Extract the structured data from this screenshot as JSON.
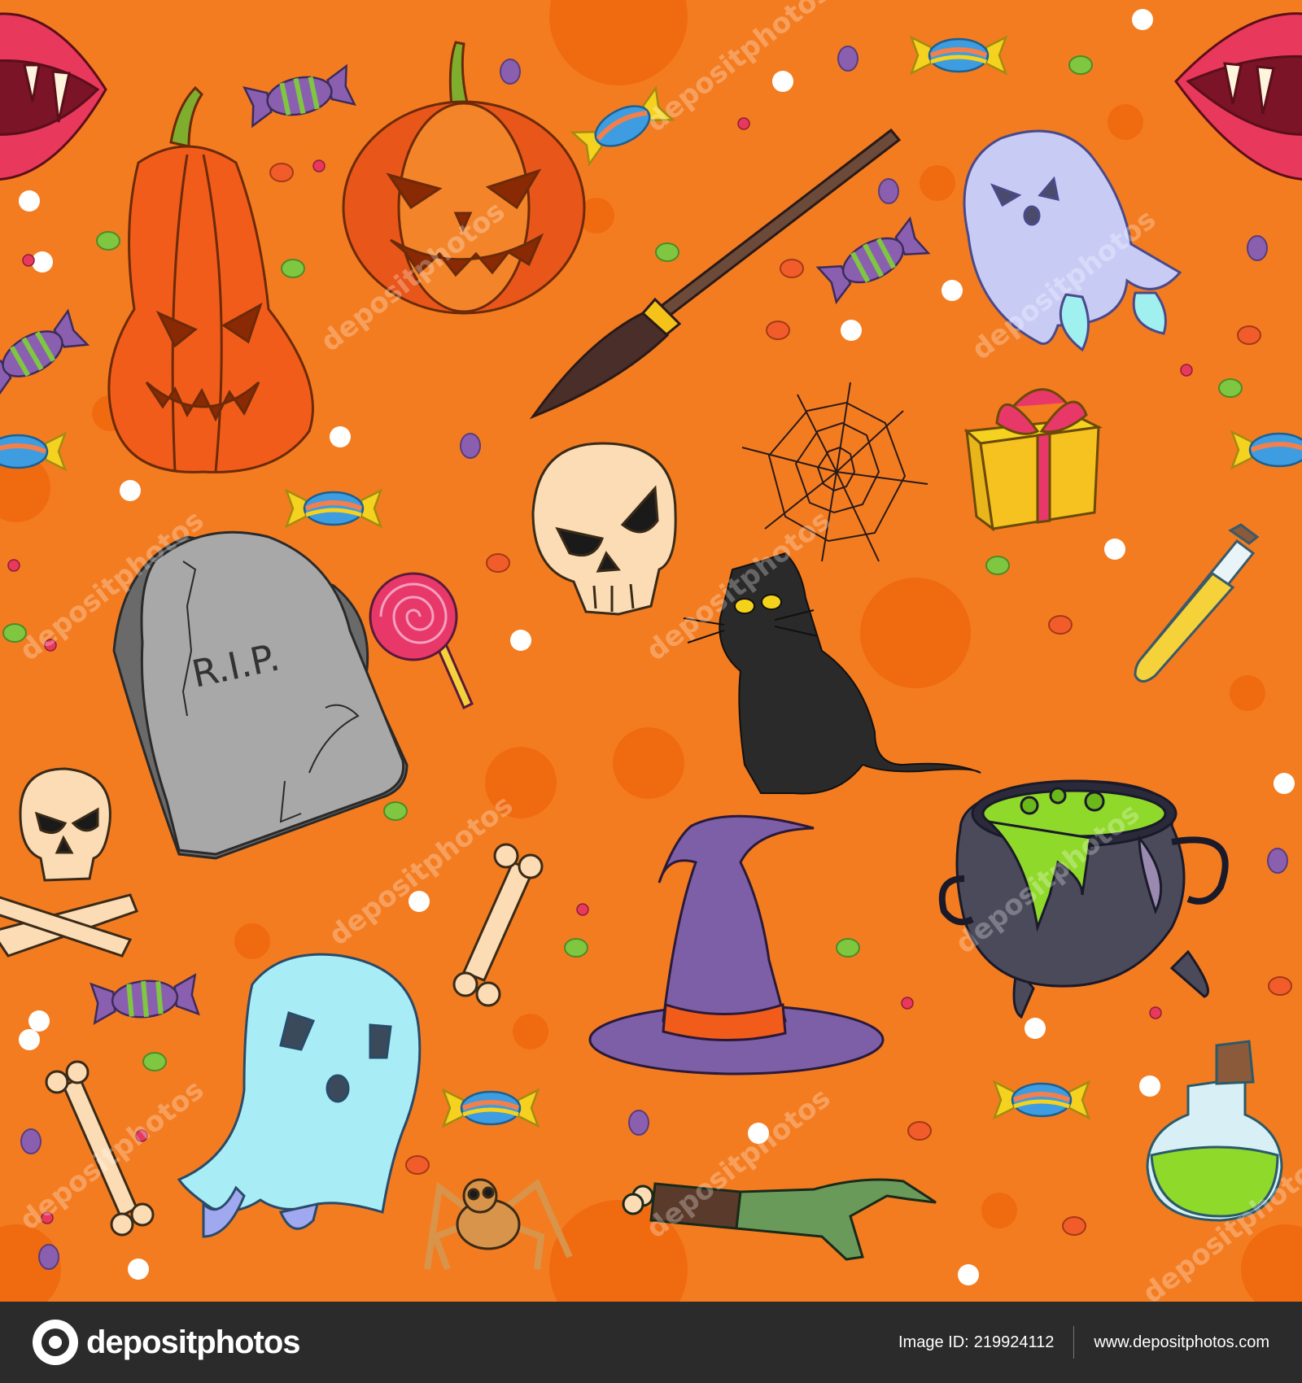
{
  "tombstone": {
    "inscription": "R.I.P."
  },
  "watermark": {
    "text": "depositphotos"
  },
  "footer": {
    "brand": "depositphotos",
    "image_id_label": "Image ID:",
    "image_id": "219924112",
    "site": "www.depositphotos.com"
  },
  "colors": {
    "background": "#f47c20",
    "footer_background": "#2b2b2b"
  }
}
